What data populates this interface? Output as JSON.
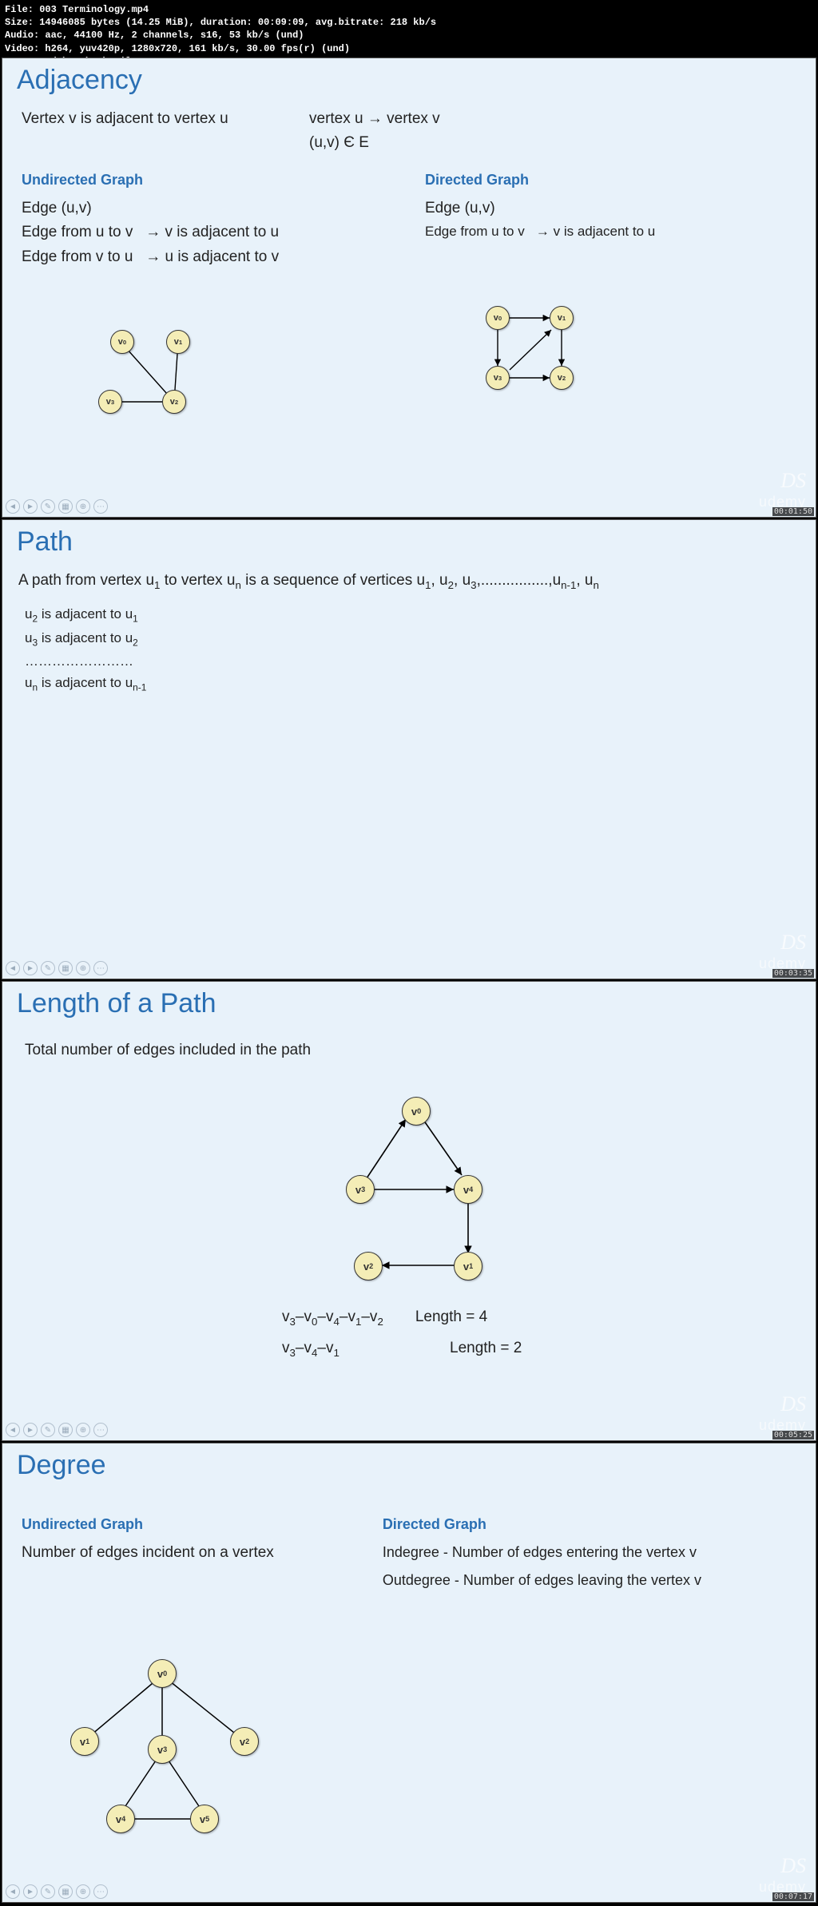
{
  "header": {
    "file_label": "File:",
    "file_value": "003 Terminology.mp4",
    "size_label": "Size:",
    "size_value": "14946085 bytes (14.25 MiB), duration: 00:09:09, avg.bitrate: 218 kb/s",
    "audio_label": "Audio:",
    "audio_value": "aac, 44100 Hz, 2 channels, s16, 53 kb/s (und)",
    "video_label": "Video:",
    "video_value": "h264, yuv420p, 1280x720, 161 kb/s, 30.00 fps(r) (und)",
    "gen": "Generated by Thumbnail me"
  },
  "slide1": {
    "title": "Adjacency",
    "intro1": "Vertex v is adjacent to vertex u",
    "intro2": "vertex u  →  vertex v",
    "intro3": "(u,v) Є E",
    "left_title": "Undirected Graph",
    "left_l1": "Edge (u,v)",
    "left_l2a": "Edge from u to v",
    "left_l2b": "→ v is adjacent to u",
    "left_l3a": "Edge from v to u",
    "left_l3b": "→ u is adjacent to v",
    "right_title": "Directed Graph",
    "right_l1": "Edge (u,v)",
    "right_l2a": "Edge from u to v",
    "right_l2b": "→ v is adjacent to u",
    "timestamp": "00:01:50",
    "v0": "v",
    "v1": "v",
    "v2": "v",
    "v3": "v"
  },
  "slide2": {
    "title": "Path",
    "intro_a": "A path from vertex u",
    "intro_b": " to vertex u",
    "intro_c": " is a sequence of vertices u",
    "intro_parts": [
      ", u",
      ", u",
      ",................,u",
      ", u"
    ],
    "l1a": "u",
    "l1b": " is adjacent to u",
    "l2a": "u",
    "l2b": " is adjacent to u",
    "dots": "……………………",
    "l3a": "u",
    "l3b": " is adjacent to u",
    "timestamp": "00:03:35"
  },
  "slide3": {
    "title": "Length of a Path",
    "intro": "Total number of edges included in the path",
    "p1a": "v",
    "p1_seq": "–v",
    "p1txt": "Length = 4",
    "p2txt": "Length = 2",
    "s30": "3",
    "s00": "0",
    "s40": "4",
    "s10": "1",
    "s20": "2",
    "timestamp": "00:05:25"
  },
  "slide4": {
    "title": "Degree",
    "left_title": "Undirected Graph",
    "left_l1": "Number of edges incident on a vertex",
    "right_title": "Directed Graph",
    "right_l1": "Indegree - Number of edges entering the vertex v",
    "right_l2": "Outdegree - Number of edges leaving the vertex v",
    "timestamp": "00:07:17"
  },
  "wm1": "DS",
  "wm2": "udemy"
}
